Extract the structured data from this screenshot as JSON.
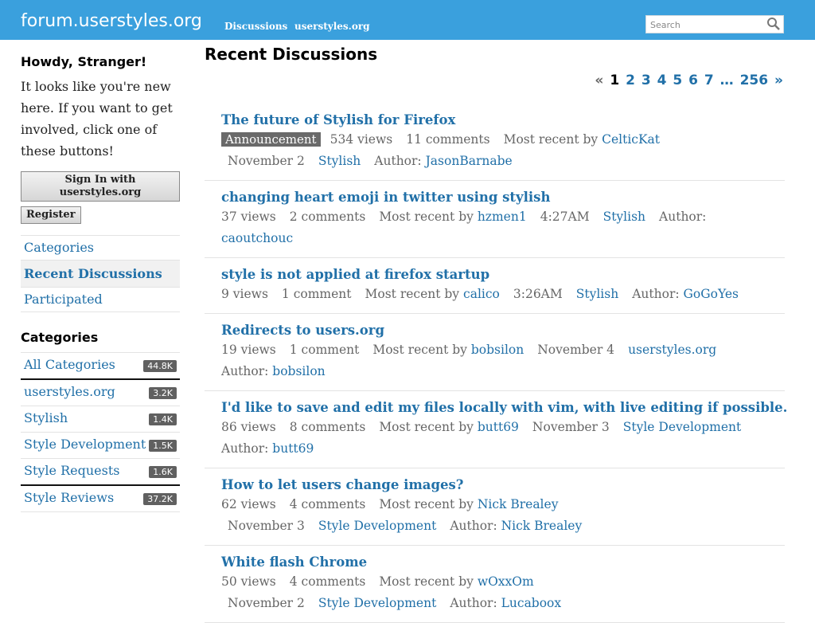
{
  "header": {
    "site_title": "forum.userstyles.org",
    "nav": [
      "Discussions",
      "userstyles.org"
    ],
    "search_placeholder": "Search",
    "bg_color": "#3aa0dd"
  },
  "sidebar": {
    "greeting": "Howdy, Stranger!",
    "intro": "It looks like you're new here. If you want to get involved, click one of these buttons!",
    "signin_label": "Sign In with userstyles.org",
    "register_label": "Register",
    "nav": [
      "Categories",
      "Recent Discussions",
      "Participated"
    ],
    "categories_heading": "Categories",
    "categories": [
      {
        "name": "All Categories",
        "count": "44.8K"
      },
      {
        "name": "userstyles.org",
        "count": "3.2K"
      },
      {
        "name": "Stylish",
        "count": "1.4K"
      },
      {
        "name": "Style Development",
        "count": "1.5K"
      },
      {
        "name": "Style Requests",
        "count": "1.6K"
      },
      {
        "name": "Style Reviews",
        "count": "37.2K"
      }
    ]
  },
  "main": {
    "title": "Recent Discussions",
    "pager": {
      "prev": "«",
      "pages": [
        "1",
        "2",
        "3",
        "4",
        "5",
        "6",
        "7"
      ],
      "ellipsis": "…",
      "last": "256",
      "next": "»"
    },
    "discussions": [
      {
        "title": "The future of Stylish for Firefox",
        "badge": "Announcement",
        "views": "534 views",
        "comments": "11 comments",
        "recent_label": "Most recent by",
        "recent_user": "CelticKat",
        "time": "November 2",
        "category": "Stylish",
        "author_label": "Author:",
        "author": "JasonBarnabe"
      },
      {
        "title": "changing heart emoji in twitter using stylish",
        "views": "37 views",
        "comments": "2 comments",
        "recent_label": "Most recent by",
        "recent_user": "hzmen1",
        "time": "4:27AM",
        "category": "Stylish",
        "author_label": "Author:",
        "author": "caoutchouc"
      },
      {
        "title": "style is not applied at firefox startup",
        "views": "9 views",
        "comments": "1 comment",
        "recent_label": "Most recent by",
        "recent_user": "calico",
        "time": "3:26AM",
        "category": "Stylish",
        "author_label": "Author:",
        "author": "GoGoYes"
      },
      {
        "title": "Redirects to users.org",
        "views": "19 views",
        "comments": "1 comment",
        "recent_label": "Most recent by",
        "recent_user": "bobsilon",
        "time": "November 4",
        "category": "userstyles.org",
        "author_label": "Author:",
        "author": "bobsilon"
      },
      {
        "title": "I'd like to save and edit my files locally with vim, with live editing if possible.",
        "views": "86 views",
        "comments": "8 comments",
        "recent_label": "Most recent by",
        "recent_user": "butt69",
        "time": "November 3",
        "category": "Style Development",
        "author_label": "Author:",
        "author": "butt69"
      },
      {
        "title": "How to let users change images?",
        "views": "62 views",
        "comments": "4 comments",
        "recent_label": "Most recent by",
        "recent_user": "Nick Brealey",
        "time": "November 3",
        "category": "Style Development",
        "author_label": "Author:",
        "author": "Nick Brealey"
      },
      {
        "title": "White flash Chrome",
        "views": "50 views",
        "comments": "4 comments",
        "recent_label": "Most recent by",
        "recent_user": "wOxxOm",
        "time": "November 2",
        "category": "Style Development",
        "author_label": "Author:",
        "author": "Lucaboox"
      }
    ]
  }
}
